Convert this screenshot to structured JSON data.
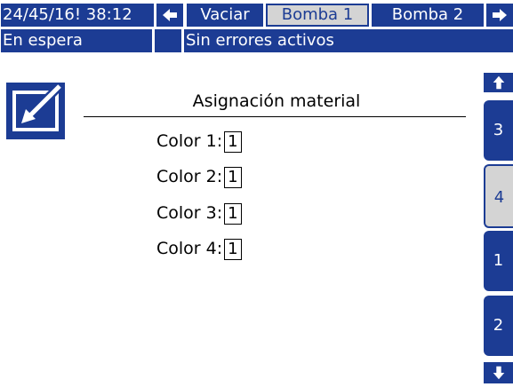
{
  "header": {
    "datetime": "24/45/16! 38:12",
    "arrow_left": "🡸",
    "tabs": [
      "Vaciar",
      "Bomba 1",
      "Bomba 2"
    ],
    "arrow_right": "🡺"
  },
  "status": {
    "state": "En espera",
    "errors": "Sin errores activos"
  },
  "main": {
    "title": "Asignación material",
    "colors": [
      {
        "label": "Color 1:",
        "value": "1"
      },
      {
        "label": "Color 2:",
        "value": "1"
      },
      {
        "label": "Color 3:",
        "value": "1"
      },
      {
        "label": "Color 4:",
        "value": "1"
      }
    ]
  },
  "side_nav": {
    "up": "🡹",
    "items": [
      "3",
      "4",
      "1",
      "2"
    ],
    "down": "🡻",
    "selected": "4"
  },
  "colors": {
    "accent": "#1c3c94",
    "selected_bg": "#d4d4d4"
  }
}
